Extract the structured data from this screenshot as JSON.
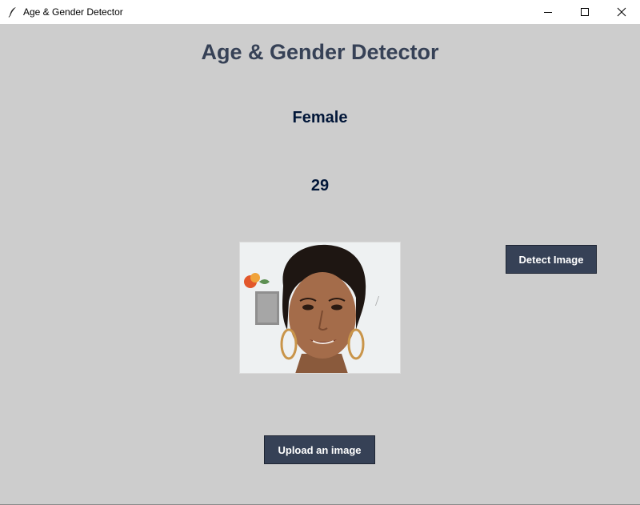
{
  "window": {
    "title": "Age & Gender Detector"
  },
  "main": {
    "heading": "Age & Gender Detector",
    "gender_label": "Female",
    "age_label": "29",
    "detect_button_label": "Detect Image",
    "upload_button_label": "Upload an image"
  },
  "icons": {
    "app": "feather-icon",
    "minimize": "minimize-icon",
    "maximize": "maximize-icon",
    "close": "close-icon"
  },
  "colors": {
    "background": "#cdcdcd",
    "heading": "#364156",
    "result_text": "#011638",
    "button_bg": "#364156",
    "button_text": "#ffffff"
  }
}
